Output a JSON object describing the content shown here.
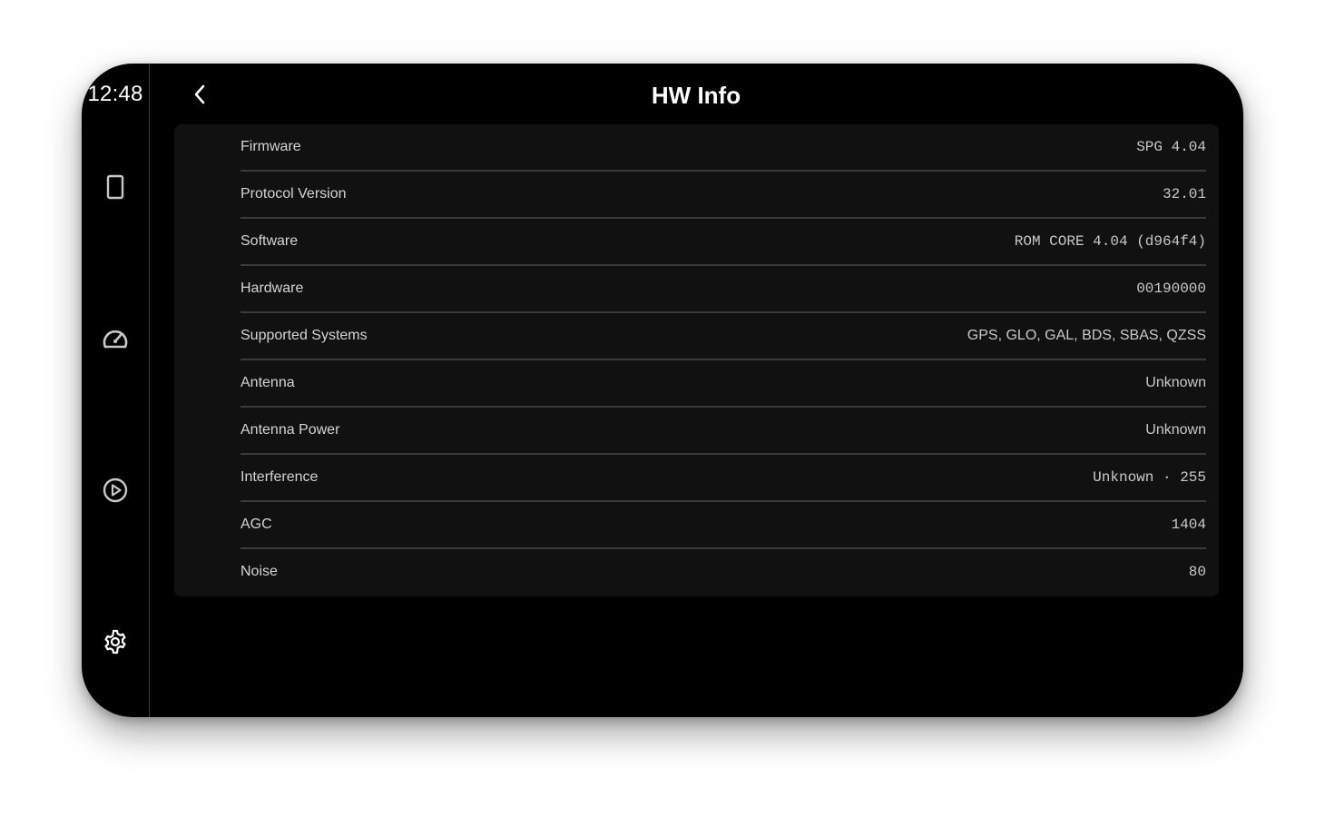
{
  "status": {
    "clock": "12:48"
  },
  "sidebar": {
    "items": [
      {
        "name": "device",
        "icon": "tablet-icon"
      },
      {
        "name": "dashboard",
        "icon": "speedometer-icon"
      },
      {
        "name": "playback",
        "icon": "play-circle-icon"
      },
      {
        "name": "settings",
        "icon": "gear-icon"
      }
    ]
  },
  "header": {
    "back_icon": "chevron-left-icon",
    "title": "HW Info"
  },
  "rows": [
    {
      "label": "Firmware",
      "value": "SPG 4.04",
      "font": "mono"
    },
    {
      "label": "Protocol Version",
      "value": "32.01",
      "font": "mono"
    },
    {
      "label": "Software",
      "value": "ROM CORE 4.04 (d964f4)",
      "font": "mono"
    },
    {
      "label": "Hardware",
      "value": "00190000",
      "font": "mono"
    },
    {
      "label": "Supported Systems",
      "value": "GPS, GLO, GAL, BDS, SBAS, QZSS",
      "font": "sans"
    },
    {
      "label": "Antenna",
      "value": "Unknown",
      "font": "sans"
    },
    {
      "label": "Antenna Power",
      "value": "Unknown",
      "font": "sans"
    },
    {
      "label": "Interference",
      "value": "Unknown · 255",
      "font": "mono"
    },
    {
      "label": "AGC",
      "value": "1404",
      "font": "mono"
    },
    {
      "label": "Noise",
      "value": "80",
      "font": "mono"
    }
  ],
  "colors": {
    "background": "#000000",
    "card": "#111111",
    "divider": "#3a3a3a",
    "text_primary": "#ffffff",
    "text_secondary": "#d4d4d4",
    "icon": "#c8c8c8"
  }
}
